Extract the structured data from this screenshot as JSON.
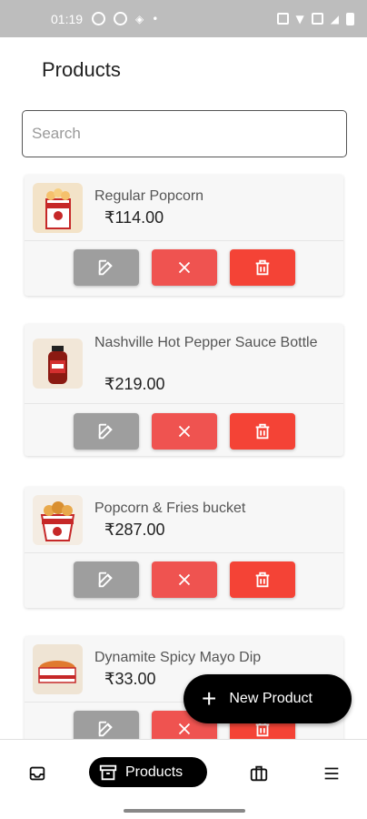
{
  "status_bar": {
    "time": "01:19",
    "icons": [
      "sync-icon",
      "sync-icon",
      "twitter-icon",
      "nfc-icon",
      "wifi-icon",
      "volte-icon",
      "signal-icon",
      "battery-icon"
    ]
  },
  "page": {
    "title": "Products"
  },
  "search": {
    "placeholder": "Search",
    "value": ""
  },
  "products": [
    {
      "name": "Regular Popcorn",
      "price": "₹114.00"
    },
    {
      "name": "Nashville Hot Pepper Sauce Bottle",
      "price": "₹219.00"
    },
    {
      "name": "Popcorn & Fries bucket",
      "price": "₹287.00"
    },
    {
      "name": "Dynamite Spicy Mayo Dip",
      "price": "₹33.00"
    }
  ],
  "fab": {
    "label": "New Product"
  },
  "nav": {
    "active_label": "Products"
  },
  "colors": {
    "edit": "#9e9e9e",
    "cancel": "#ef5350",
    "delete": "#f44336",
    "accent": "#000000"
  }
}
